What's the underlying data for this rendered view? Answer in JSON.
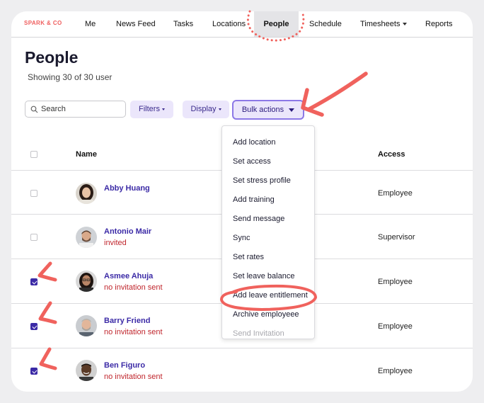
{
  "nav": {
    "brand": "SPARK & CO",
    "items": [
      {
        "label": "Me"
      },
      {
        "label": "News Feed"
      },
      {
        "label": "Tasks"
      },
      {
        "label": "Locations"
      },
      {
        "label": "People"
      },
      {
        "label": "Schedule"
      },
      {
        "label": "Timesheets"
      },
      {
        "label": "Reports"
      }
    ],
    "active": "People"
  },
  "page": {
    "title": "People",
    "subtitle": "Showing 30 of 30 user"
  },
  "toolbar": {
    "search_placeholder": "Search",
    "filters_label": "Filters",
    "display_label": "Display",
    "bulk_label": "Bulk actions"
  },
  "table": {
    "headers": {
      "name": "Name",
      "access": "Access"
    },
    "rows": [
      {
        "name": "Abby Huang",
        "status": "",
        "access": "Employee",
        "checked": false
      },
      {
        "name": "Antonio Mair",
        "status": "invited",
        "access": "Supervisor",
        "checked": false
      },
      {
        "name": "Asmee Ahuja",
        "status": "no invitation sent",
        "access": "Employee",
        "checked": true
      },
      {
        "name": "Barry Friend",
        "status": "no invitation sent",
        "access": "Employee",
        "checked": true
      },
      {
        "name": "Ben Figuro",
        "status": "no invitation sent",
        "access": "Employee",
        "checked": true
      }
    ]
  },
  "bulk_menu": {
    "items": [
      {
        "label": "Add location",
        "enabled": true
      },
      {
        "label": "Set access",
        "enabled": true
      },
      {
        "label": "Set stress profile",
        "enabled": true
      },
      {
        "label": "Add training",
        "enabled": true
      },
      {
        "label": "Send message",
        "enabled": true
      },
      {
        "label": "Sync",
        "enabled": true
      },
      {
        "label": "Set rates",
        "enabled": true
      },
      {
        "label": "Set leave balance",
        "enabled": true
      },
      {
        "label": "Add leave entitlement",
        "enabled": true,
        "highlighted": true
      },
      {
        "label": "Archive employeee",
        "enabled": true
      },
      {
        "label": "Send Invitation",
        "enabled": false
      }
    ]
  },
  "colors": {
    "brand": "#ef5e5e",
    "accent": "#3b2aa6",
    "annotation": "#f0625d",
    "status_red": "#c0262d"
  },
  "icons": {
    "search": "search-icon",
    "dropdown": "chevron-down-icon"
  }
}
